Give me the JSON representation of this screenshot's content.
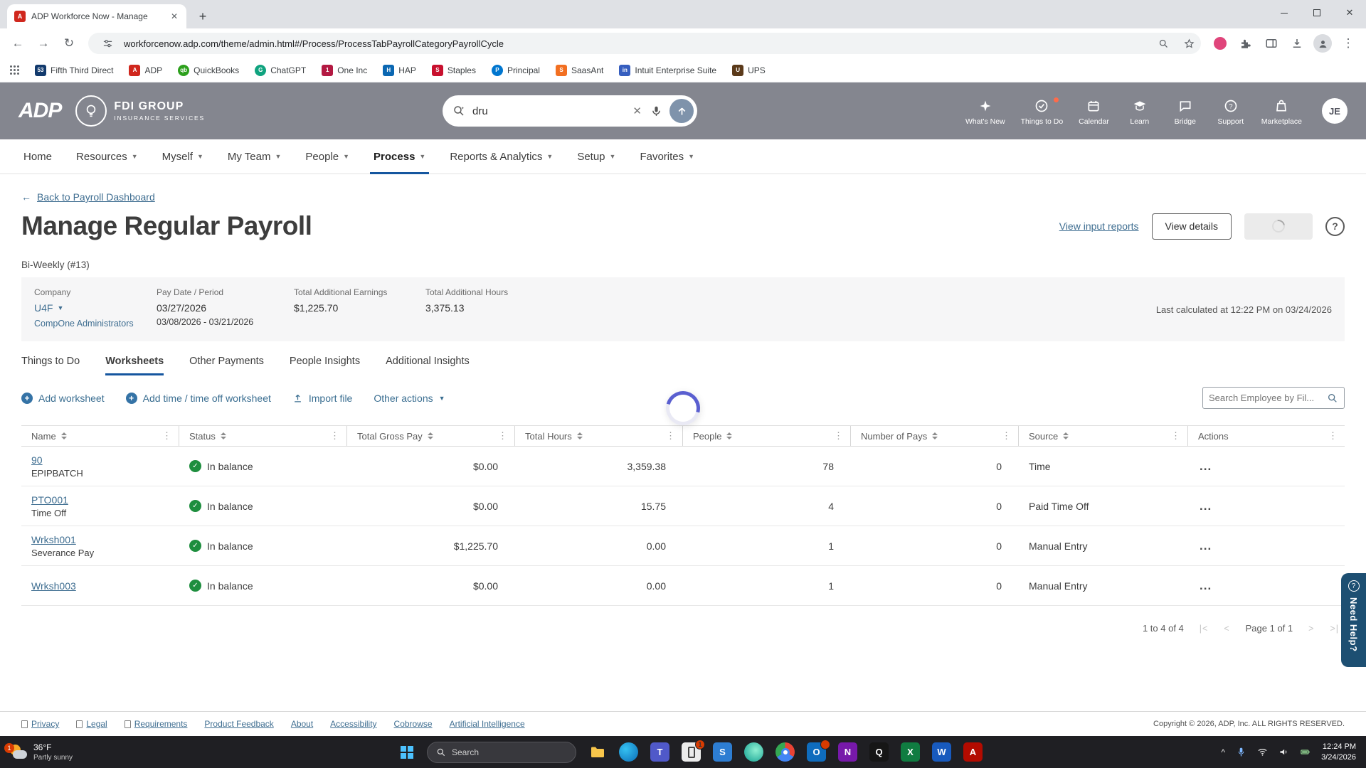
{
  "colors": {
    "adp_header_bg": "#84868F",
    "active_tab_underline": "#15569F",
    "link_blue": "#3F6E91",
    "status_green": "#1E8E3E",
    "need_help_bg": "#1D4F72",
    "spinner_blue": "#5A5FD0"
  },
  "browser": {
    "tab_title": "ADP Workforce Now - Manage",
    "url": "workforcenow.adp.com/theme/admin.html#/Process/ProcessTabPayrollCategoryPayrollCycle",
    "bookmarks": [
      {
        "label": "Fifth Third Direct"
      },
      {
        "label": "ADP"
      },
      {
        "label": "QuickBooks"
      },
      {
        "label": "ChatGPT"
      },
      {
        "label": "One Inc"
      },
      {
        "label": "HAP"
      },
      {
        "label": "Staples"
      },
      {
        "label": "Principal"
      },
      {
        "label": "SaasAnt"
      },
      {
        "label": "Intuit Enterprise Suite"
      },
      {
        "label": "UPS"
      }
    ]
  },
  "header": {
    "logo": "ADP",
    "company_name": "FDI GROUP",
    "company_tagline": "INSURANCE SERVICES",
    "search_value": "dru",
    "menu": [
      {
        "label": "What's New"
      },
      {
        "label": "Things to Do"
      },
      {
        "label": "Calendar"
      },
      {
        "label": "Learn"
      },
      {
        "label": "Bridge"
      },
      {
        "label": "Support"
      },
      {
        "label": "Marketplace"
      }
    ],
    "avatar": "JE"
  },
  "nav": {
    "items": [
      {
        "label": "Home"
      },
      {
        "label": "Resources"
      },
      {
        "label": "Myself"
      },
      {
        "label": "My Team"
      },
      {
        "label": "People"
      },
      {
        "label": "Process"
      },
      {
        "label": "Reports & Analytics"
      },
      {
        "label": "Setup"
      },
      {
        "label": "Favorites"
      }
    ]
  },
  "page": {
    "back_link": "Back to Payroll Dashboard",
    "title": "Manage Regular Payroll",
    "view_input_reports": "View input reports",
    "view_details": "View details",
    "schedule": "Bi-Weekly (#13)",
    "summary": {
      "company_label": "Company",
      "company_value": "U4F",
      "company_link": "CompOne Administrators",
      "paydate_label": "Pay Date / Period",
      "paydate_value": "03/27/2026",
      "period_value": "03/08/2026 - 03/21/2026",
      "earnings_label": "Total Additional Earnings",
      "earnings_value": "$1,225.70",
      "hours_label": "Total Additional Hours",
      "hours_value": "3,375.13",
      "last_calculated": "Last calculated at 12:22 PM on 03/24/2026"
    },
    "tabs": [
      "Things to Do",
      "Worksheets",
      "Other Payments",
      "People Insights",
      "Additional Insights"
    ],
    "actions": {
      "add_worksheet": "Add worksheet",
      "add_time": "Add time / time off worksheet",
      "import_file": "Import file",
      "other_actions": "Other actions"
    },
    "search_placeholder": "Search Employee by Fil...",
    "table": {
      "columns": [
        "Name",
        "Status",
        "Total Gross Pay",
        "Total Hours",
        "People",
        "Number of Pays",
        "Source",
        "Actions"
      ],
      "rows": [
        {
          "name": "90",
          "sub": "EPIPBATCH",
          "status": "In balance",
          "gross": "$0.00",
          "hours": "3,359.38",
          "people": "78",
          "pays": "0",
          "source": "Time"
        },
        {
          "name": "PTO001",
          "sub": "Time Off",
          "status": "In balance",
          "gross": "$0.00",
          "hours": "15.75",
          "people": "4",
          "pays": "0",
          "source": "Paid Time Off"
        },
        {
          "name": "Wrksh001",
          "sub": "Severance Pay",
          "status": "In balance",
          "gross": "$1,225.70",
          "hours": "0.00",
          "people": "1",
          "pays": "0",
          "source": "Manual Entry"
        },
        {
          "name": "Wrksh003",
          "sub": "",
          "status": "In balance",
          "gross": "$0.00",
          "hours": "0.00",
          "people": "1",
          "pays": "0",
          "source": "Manual Entry"
        }
      ],
      "pagination": {
        "range": "1 to 4 of 4",
        "page": "Page 1 of 1"
      }
    },
    "need_help": "Need Help?"
  },
  "footer": {
    "links": [
      "Privacy",
      "Legal",
      "Requirements",
      "Product Feedback",
      "About",
      "Accessibility",
      "Cobrowse",
      "Artificial Intelligence"
    ],
    "copyright": "Copyright © 2026, ADP, Inc. ALL RIGHTS RESERVED."
  },
  "taskbar": {
    "weather_badge": "1",
    "weather_temp": "36°F",
    "weather_desc": "Partly sunny",
    "search_placeholder": "Search",
    "phone_badge": "1",
    "time": "12:24 PM",
    "date": "3/24/2026"
  }
}
